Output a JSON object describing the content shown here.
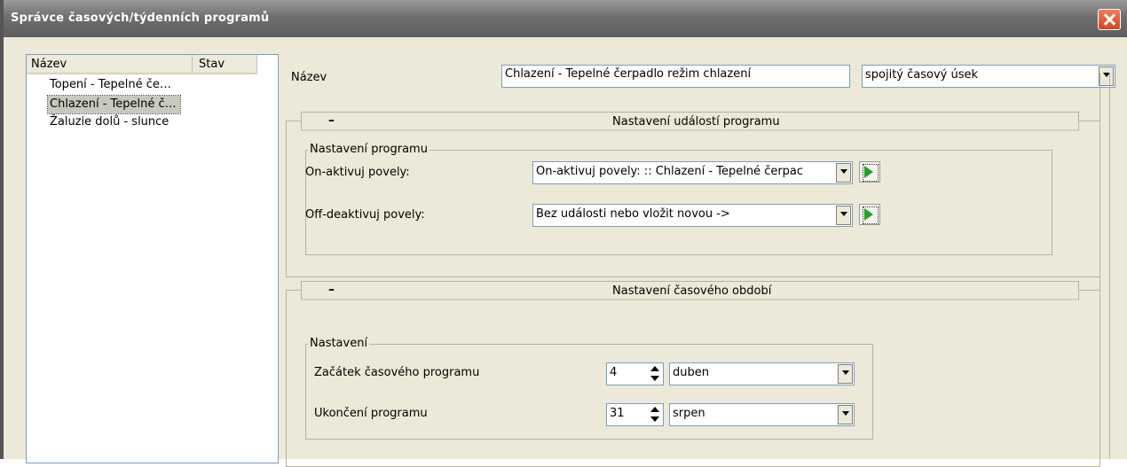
{
  "window": {
    "title": "Správce časových/týdenních programů"
  },
  "list": {
    "headers": {
      "name": "Název",
      "status": "Stav"
    },
    "items": [
      {
        "label": "Topení - Tepelné če…"
      },
      {
        "label": "Chlazení - Tepelné č…"
      },
      {
        "label": "Žaluzie dolů - slunce"
      }
    ]
  },
  "form": {
    "name_label": "Název",
    "name_value": "Chlazení - Tepelné čerpadlo režim chlazení",
    "type_value": "spojitý časový úsek"
  },
  "events_group": {
    "toggle": "–",
    "title": "Nastavení událostí programu",
    "fieldset_legend": "Nastavení programu",
    "on_label": "On-aktivuj povely:",
    "on_value": "On-aktivuj povely: :: Chlazení - Tepelné čerpac",
    "off_label": "Off-deaktivuj povely:",
    "off_value": "Bez události nebo vložit novou ->"
  },
  "period_group": {
    "toggle": "–",
    "title": "Nastavení časového období",
    "fieldset_legend": "Nastavení",
    "start_label": "Začátek časového programu",
    "start_day": "4",
    "start_month": "duben",
    "end_label": "Ukončení programu",
    "end_day": "31",
    "end_month": "srpen"
  },
  "colors": {
    "titlebar": "#6f6f6f",
    "close": "#d8451f",
    "background": "#ece9d8",
    "selected": "#c9c8c0"
  },
  "icons": {
    "close": "close-icon",
    "event_button": "play-event-icon"
  }
}
